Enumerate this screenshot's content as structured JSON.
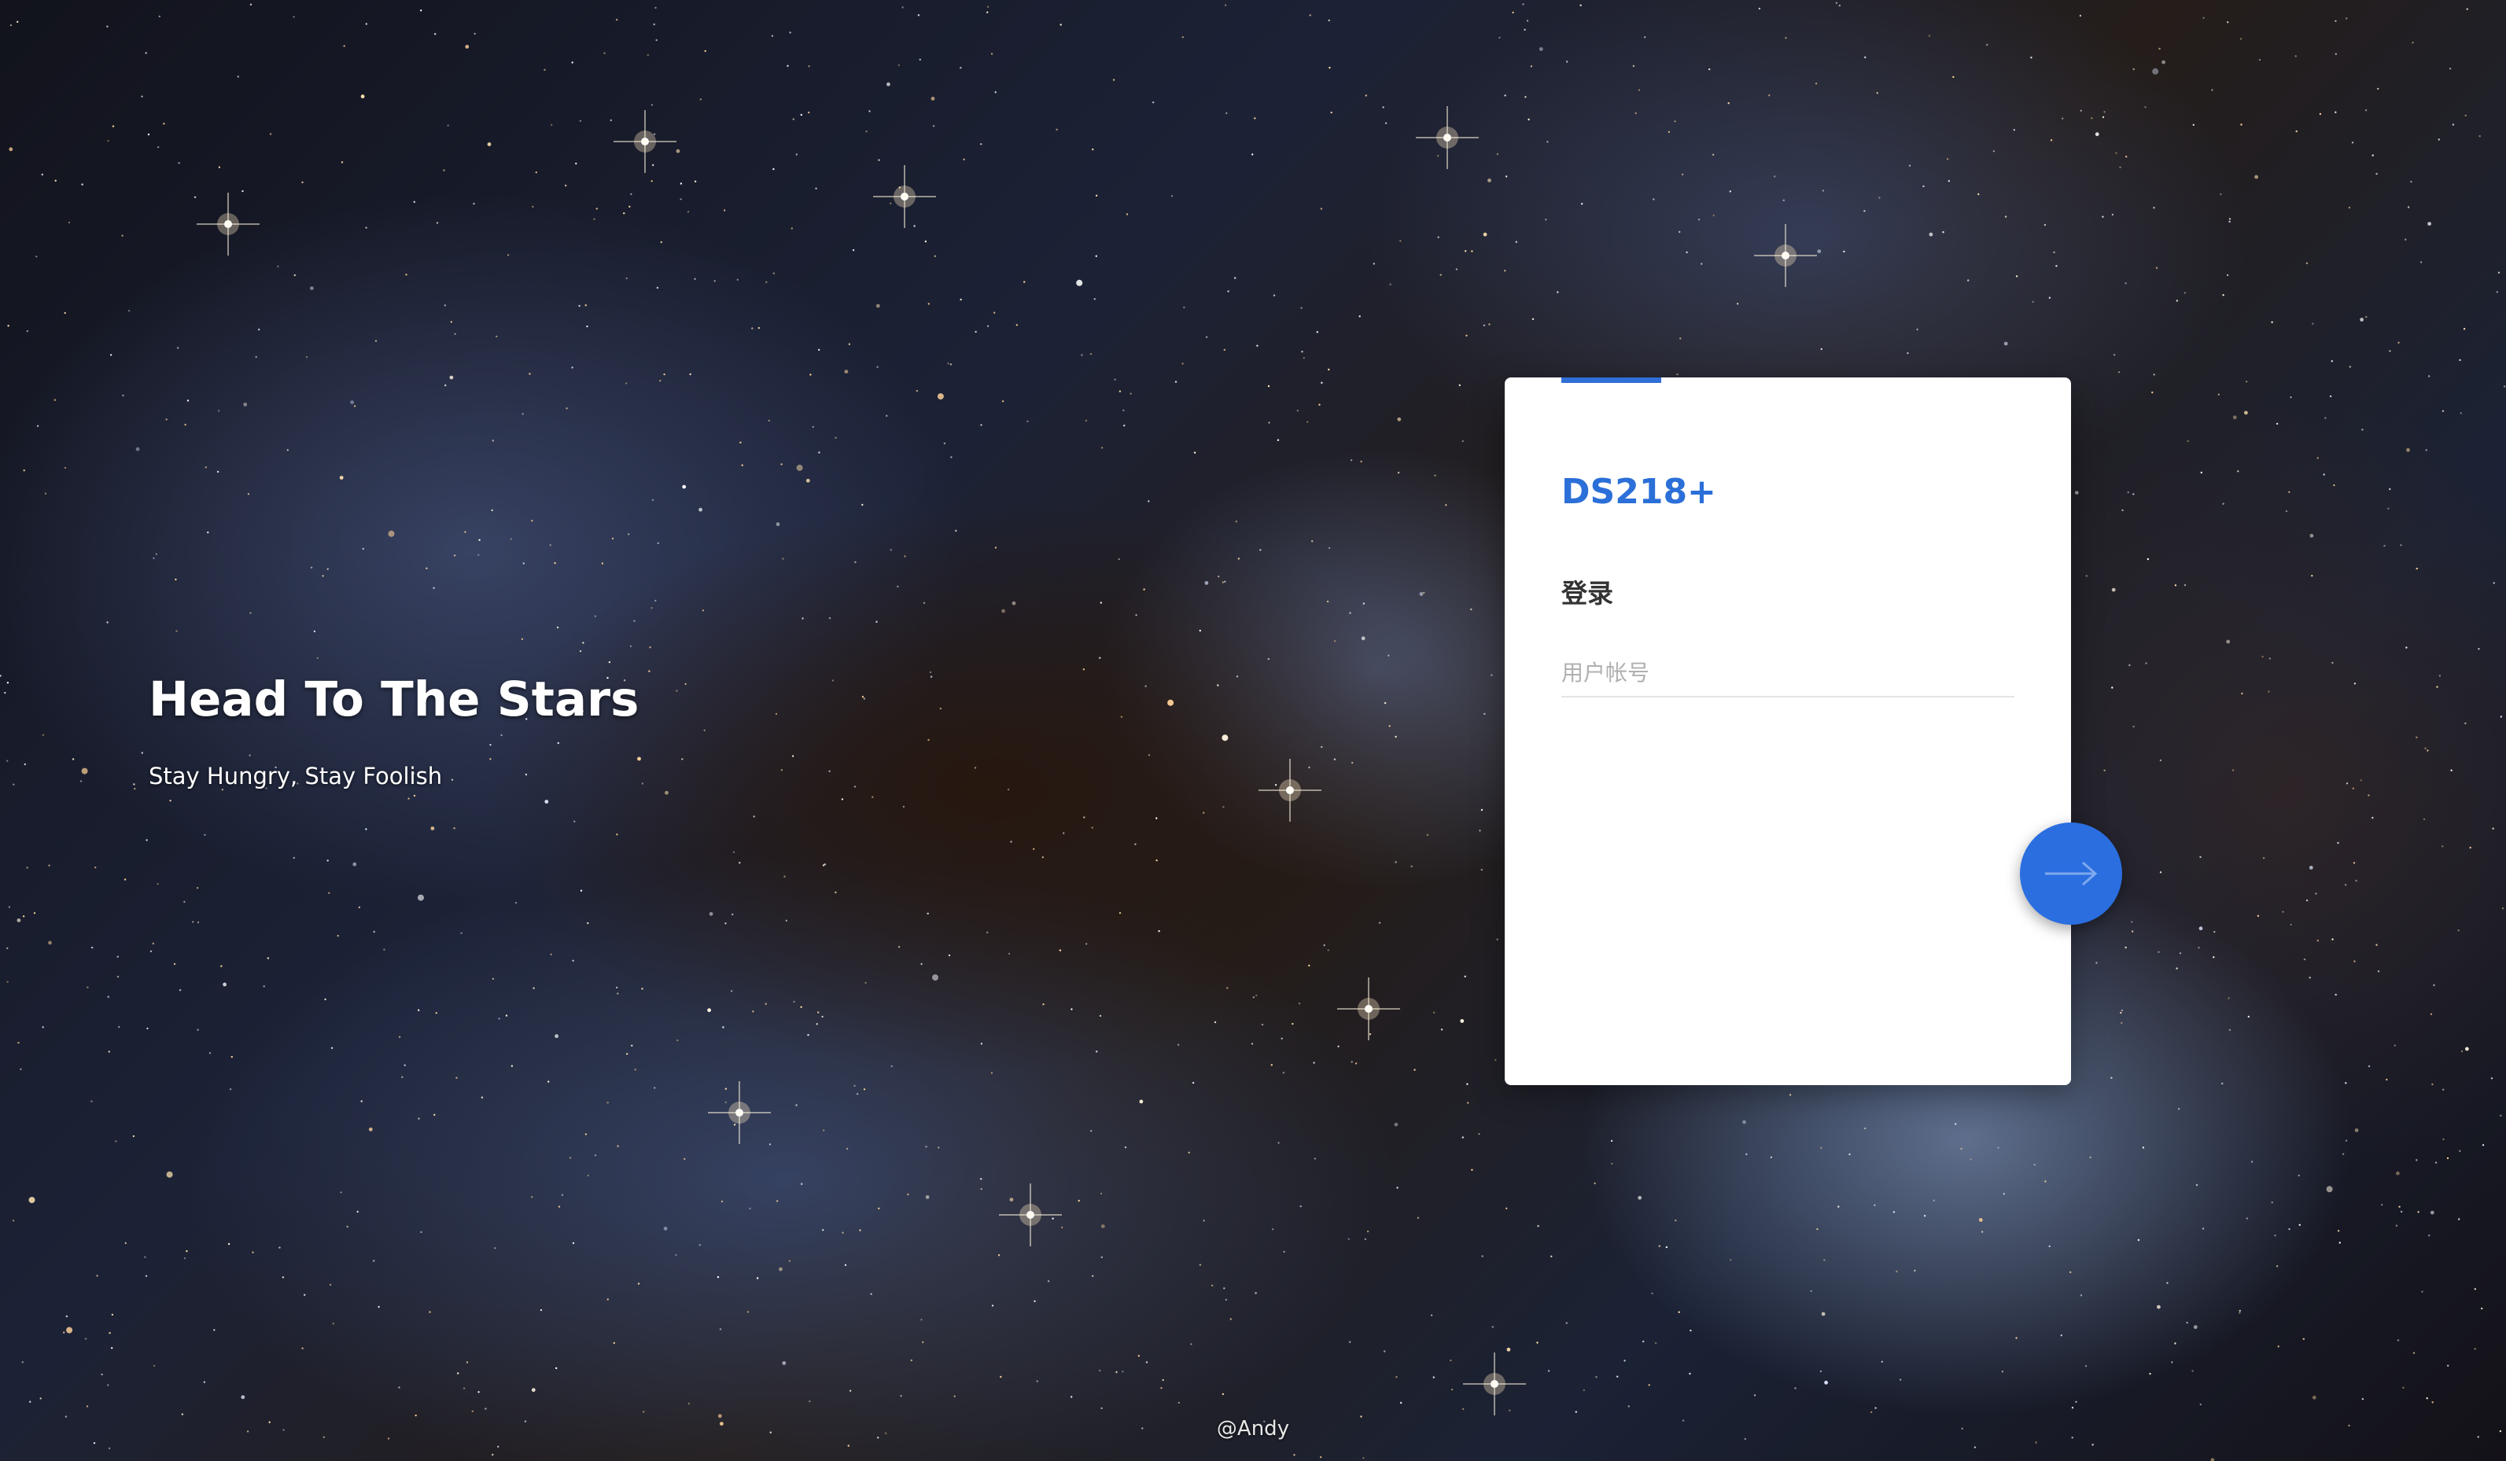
{
  "hero": {
    "title": "Head To The Stars",
    "subtitle": "Stay Hungry, Stay Foolish"
  },
  "login": {
    "device_name": "DS218+",
    "heading": "登录",
    "username_placeholder": "用户帐号",
    "username_value": "",
    "submit_icon": "arrow-right-icon"
  },
  "footer": {
    "credit": "@Andy"
  },
  "colors": {
    "accent": "#2b6fd8",
    "button": "#2a6ee0",
    "card_background": "#ffffff"
  }
}
